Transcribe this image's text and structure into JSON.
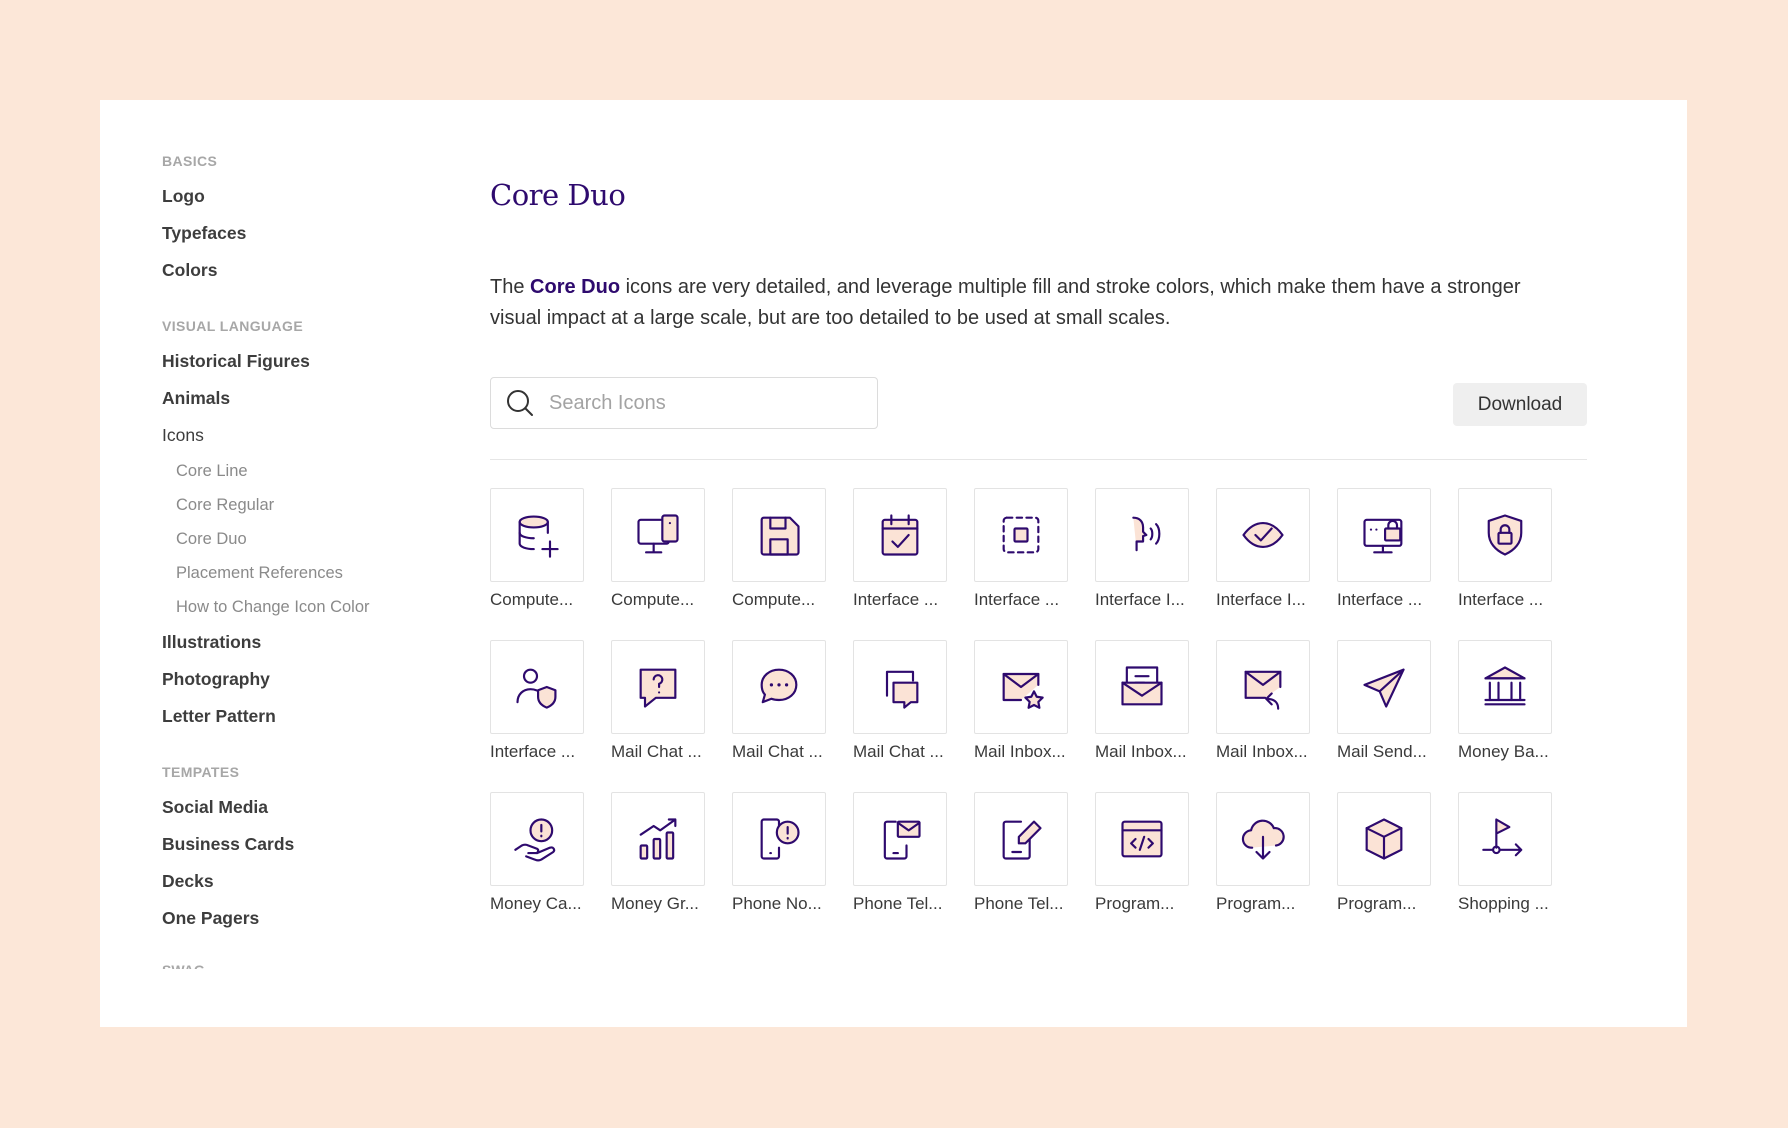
{
  "sidebar": {
    "sections": [
      {
        "heading": "BASICS",
        "items": [
          {
            "label": "Logo"
          },
          {
            "label": "Typefaces"
          },
          {
            "label": "Colors"
          }
        ]
      },
      {
        "heading": "VISUAL LANGUAGE",
        "items": [
          {
            "label": "Historical Figures"
          },
          {
            "label": "Animals"
          },
          {
            "label": "Icons"
          },
          {
            "label": "Core Line"
          },
          {
            "label": "Core Regular"
          },
          {
            "label": "Core Duo"
          },
          {
            "label": "Placement References"
          },
          {
            "label": "How to Change Icon Color"
          },
          {
            "label": "Illustrations"
          },
          {
            "label": "Photography"
          },
          {
            "label": "Letter Pattern"
          }
        ]
      },
      {
        "heading": "TEMPATES",
        "items": [
          {
            "label": "Social Media"
          },
          {
            "label": "Business Cards"
          },
          {
            "label": "Decks"
          },
          {
            "label": "One Pagers"
          }
        ]
      },
      {
        "heading": "SWAG"
      }
    ]
  },
  "main": {
    "title": "Core Duo",
    "description": {
      "prefix": "The ",
      "highlight": "Core Duo",
      "suffix": " icons are very detailed, and leverage multiple fill and stroke colors, which make them have a stronger visual impact at a large scale, but are too detailed to be used at small scales."
    },
    "search_placeholder": "Search Icons",
    "download_label": "Download"
  },
  "icons": [
    {
      "label": "Compute...",
      "icon": "database-add-icon"
    },
    {
      "label": "Compute...",
      "icon": "monitor-phone-icon"
    },
    {
      "label": "Compute...",
      "icon": "floppy-disk-icon"
    },
    {
      "label": "Interface ...",
      "icon": "calendar-check-icon"
    },
    {
      "label": "Interface ...",
      "icon": "focus-frame-icon"
    },
    {
      "label": "Interface I...",
      "icon": "voice-speak-icon"
    },
    {
      "label": "Interface I...",
      "icon": "eye-check-icon"
    },
    {
      "label": "Interface ...",
      "icon": "monitor-lock-icon"
    },
    {
      "label": "Interface ...",
      "icon": "shield-lock-icon"
    },
    {
      "label": "Interface ...",
      "icon": "user-shield-icon"
    },
    {
      "label": "Mail Chat ...",
      "icon": "chat-question-icon"
    },
    {
      "label": "Mail Chat ...",
      "icon": "chat-dots-icon"
    },
    {
      "label": "Mail Chat ...",
      "icon": "chat-bubbles-icon"
    },
    {
      "label": "Mail Inbox...",
      "icon": "mail-star-icon"
    },
    {
      "label": "Mail Inbox...",
      "icon": "mail-inbox-icon"
    },
    {
      "label": "Mail Inbox...",
      "icon": "mail-reply-icon"
    },
    {
      "label": "Mail Send...",
      "icon": "paper-plane-icon"
    },
    {
      "label": "Money Ba...",
      "icon": "bank-icon"
    },
    {
      "label": "Money Ca...",
      "icon": "hand-coin-icon"
    },
    {
      "label": "Money Gr...",
      "icon": "graph-bar-increase-icon"
    },
    {
      "label": "Phone No...",
      "icon": "phone-alert-icon"
    },
    {
      "label": "Phone Tel...",
      "icon": "phone-mail-icon"
    },
    {
      "label": "Phone Tel...",
      "icon": "phone-edit-icon"
    },
    {
      "label": "Program...",
      "icon": "browser-code-icon"
    },
    {
      "label": "Program...",
      "icon": "cloud-download-icon"
    },
    {
      "label": "Program...",
      "icon": "cube-icon"
    },
    {
      "label": "Shopping ...",
      "icon": "flag-route-icon"
    }
  ],
  "colors": {
    "stroke": "#2e0a6e",
    "fill": "#fbe3d6",
    "background": "#fce7d8"
  }
}
